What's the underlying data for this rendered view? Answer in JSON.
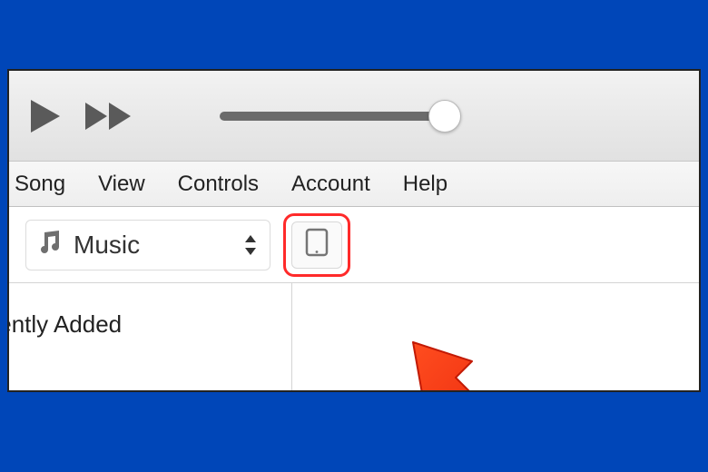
{
  "menu": {
    "song": "Song",
    "view": "View",
    "controls": "Controls",
    "account": "Account",
    "help": "Help"
  },
  "library_picker": {
    "label": "Music"
  },
  "sidebar": {
    "items": [
      {
        "label": "Recently Added"
      }
    ]
  }
}
